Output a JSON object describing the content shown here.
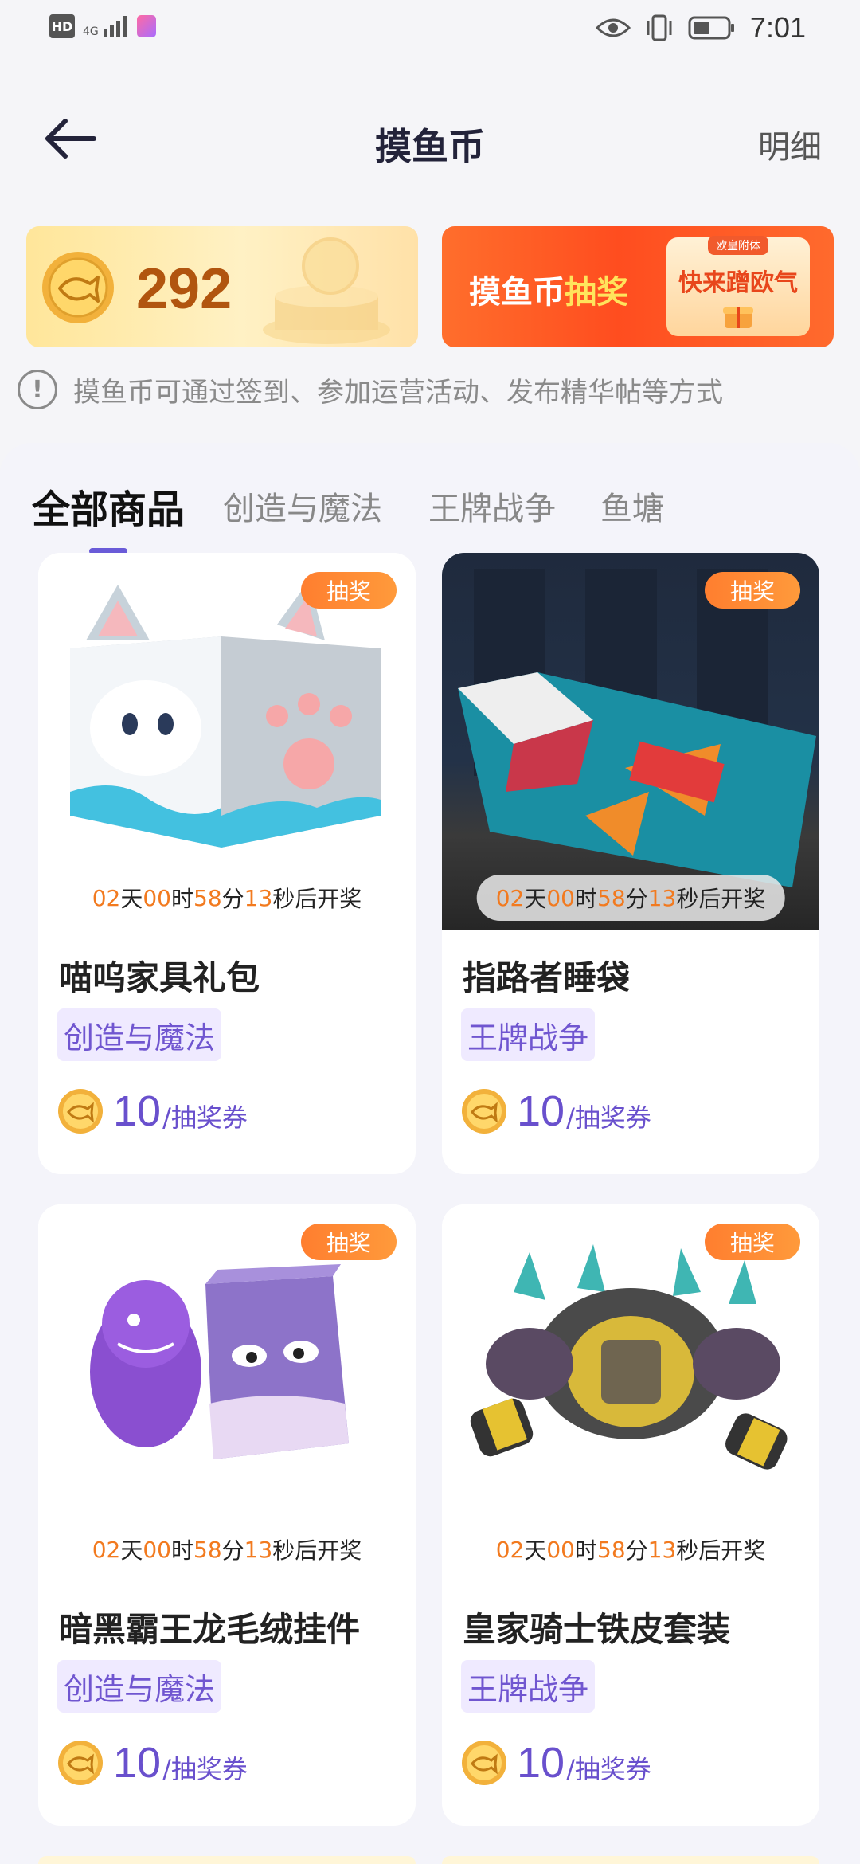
{
  "status_bar": {
    "hd": "HD",
    "network": "4G",
    "time": "7:01"
  },
  "header": {
    "title": "摸鱼币",
    "detail": "明细"
  },
  "coin_banner": {
    "balance": "292"
  },
  "lottery_banner": {
    "title_part1": "摸鱼币",
    "title_part2": "抽奖",
    "tag_top": "欧皇附体",
    "tag_text": "快来蹭欧气"
  },
  "notice": {
    "text": "摸鱼币可通过签到、参加运营活动、发布精华帖等方式"
  },
  "tabs": [
    {
      "label": "全部商品",
      "active": true
    },
    {
      "label": "创造与魔法",
      "active": false
    },
    {
      "label": "王牌战争",
      "active": false
    },
    {
      "label": "鱼塘",
      "active": false
    }
  ],
  "countdown": {
    "days": "02",
    "days_label": "天",
    "hours": "00",
    "hours_label": "时",
    "minutes": "58",
    "minutes_label": "分",
    "seconds": "13",
    "seconds_label": "秒后开奖"
  },
  "products": [
    {
      "badge": "抽奖",
      "name": "喵呜家具礼包",
      "category": "创造与魔法",
      "price": "10",
      "unit": "/抽奖券"
    },
    {
      "badge": "抽奖",
      "name": "指路者睡袋",
      "category": "王牌战争",
      "price": "10",
      "unit": "/抽奖券"
    },
    {
      "badge": "抽奖",
      "name": "暗黑霸王龙毛绒挂件",
      "category": "创造与魔法",
      "price": "10",
      "unit": "/抽奖券"
    },
    {
      "badge": "抽奖",
      "name": "皇家骑士铁皮套装",
      "category": "王牌战争",
      "price": "10",
      "unit": "/抽奖券"
    }
  ],
  "colors": {
    "accent": "#6a5bd8",
    "badge": "#ff8a33",
    "countdown_number": "#f27a1f",
    "category_bg": "#efeaff",
    "category_text": "#7056d0"
  }
}
